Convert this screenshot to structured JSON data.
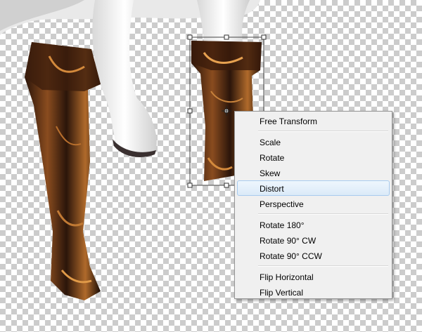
{
  "context_menu": {
    "groups": [
      [
        "Free Transform"
      ],
      [
        "Scale",
        "Rotate",
        "Skew",
        "Distort",
        "Perspective"
      ],
      [
        "Rotate 180°",
        "Rotate 90° CW",
        "Rotate 90° CCW"
      ],
      [
        "Flip Horizontal",
        "Flip Vertical"
      ]
    ],
    "items": {
      "free_transform": "Free Transform",
      "scale": "Scale",
      "rotate": "Rotate",
      "skew": "Skew",
      "distort": "Distort",
      "perspective": "Perspective",
      "rotate_180": "Rotate 180°",
      "rotate_90_cw": "Rotate 90° CW",
      "rotate_90_ccw": "Rotate 90° CCW",
      "flip_horizontal": "Flip Horizontal",
      "flip_vertical": "Flip Vertical"
    },
    "highlighted_item": "Distort"
  },
  "colors": {
    "menu_bg": "#f0f0f0",
    "highlight": "#dbeaf8",
    "highlight_border": "#a8cbee",
    "boot_dark": "#1e0f07",
    "boot_highlight": "#c77a32"
  }
}
